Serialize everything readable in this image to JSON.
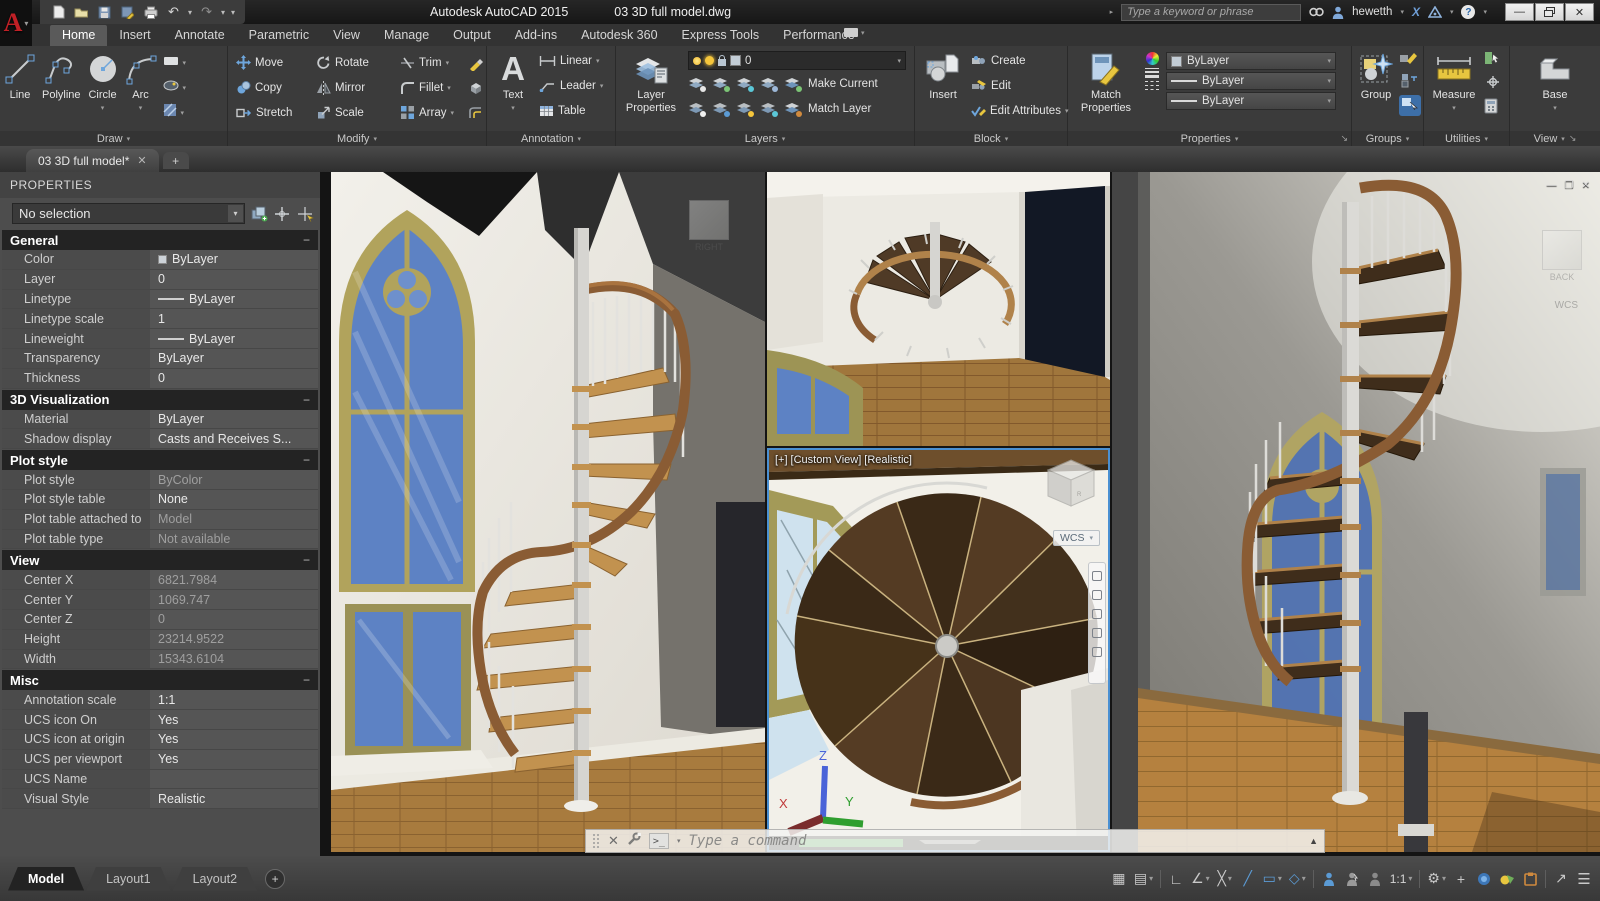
{
  "title_bar": {
    "app_title": "Autodesk AutoCAD 2015",
    "doc_title": "03 3D full model.dwg",
    "search_placeholder": "Type a keyword or phrase",
    "username": "hewetth"
  },
  "ribbon": {
    "tabs": [
      "Home",
      "Insert",
      "Annotate",
      "Parametric",
      "View",
      "Manage",
      "Output",
      "Add-ins",
      "Autodesk 360",
      "Express Tools",
      "Performance"
    ],
    "active_tab": "Home",
    "draw": {
      "label": "Draw",
      "line": "Line",
      "polyline": "Polyline",
      "circle": "Circle",
      "arc": "Arc"
    },
    "modify": {
      "label": "Modify",
      "move": "Move",
      "rotate": "Rotate",
      "trim": "Trim",
      "copy": "Copy",
      "mirror": "Mirror",
      "fillet": "Fillet",
      "stretch": "Stretch",
      "scale": "Scale",
      "array": "Array"
    },
    "annotation": {
      "label": "Annotation",
      "text": "Text",
      "linear": "Linear",
      "leader": "Leader",
      "table": "Table"
    },
    "layers": {
      "label": "Layers",
      "layer_properties": "Layer Properties",
      "current_layer": "0",
      "make_current": "Make Current",
      "match_layer": "Match Layer"
    },
    "block": {
      "label": "Block",
      "insert": "Insert",
      "create": "Create",
      "edit": "Edit",
      "edit_attributes": "Edit Attributes"
    },
    "properties": {
      "label": "Properties",
      "match_properties": "Match Properties",
      "color": "ByLayer",
      "lineweight": "ByLayer",
      "linetype": "ByLayer"
    },
    "groups": {
      "label": "Groups",
      "group": "Group"
    },
    "utilities": {
      "label": "Utilities",
      "measure": "Measure"
    },
    "view": {
      "label": "View",
      "base": "Base"
    }
  },
  "file_tabs": {
    "active": "03 3D full model*"
  },
  "properties_palette": {
    "title": "PROPERTIES",
    "selector": "No selection",
    "sections": [
      {
        "title": "General",
        "rows": [
          {
            "label": "Color",
            "value": "ByLayer",
            "prefix": "swatch"
          },
          {
            "label": "Layer",
            "value": "0"
          },
          {
            "label": "Linetype",
            "value": "ByLayer",
            "prefix": "line"
          },
          {
            "label": "Linetype scale",
            "value": "1"
          },
          {
            "label": "Lineweight",
            "value": "ByLayer",
            "prefix": "line"
          },
          {
            "label": "Transparency",
            "value": "ByLayer"
          },
          {
            "label": "Thickness",
            "value": "0"
          }
        ]
      },
      {
        "title": "3D Visualization",
        "rows": [
          {
            "label": "Material",
            "value": "ByLayer"
          },
          {
            "label": "Shadow display",
            "value": "Casts and Receives S..."
          }
        ]
      },
      {
        "title": "Plot style",
        "rows": [
          {
            "label": "Plot style",
            "value": "ByColor",
            "dim": true
          },
          {
            "label": "Plot style table",
            "value": "None"
          },
          {
            "label": "Plot table attached to",
            "value": "Model",
            "dim": true
          },
          {
            "label": "Plot table type",
            "value": "Not available",
            "dim": true
          }
        ]
      },
      {
        "title": "View",
        "rows": [
          {
            "label": "Center X",
            "value": "6821.7984",
            "dim": true
          },
          {
            "label": "Center Y",
            "value": "1069.747",
            "dim": true
          },
          {
            "label": "Center Z",
            "value": "0",
            "dim": true
          },
          {
            "label": "Height",
            "value": "23214.9522",
            "dim": true
          },
          {
            "label": "Width",
            "value": "15343.6104",
            "dim": true
          }
        ]
      },
      {
        "title": "Misc",
        "rows": [
          {
            "label": "Annotation scale",
            "value": "1:1"
          },
          {
            "label": "UCS icon On",
            "value": "Yes"
          },
          {
            "label": "UCS icon at origin",
            "value": "Yes"
          },
          {
            "label": "UCS per viewport",
            "value": "Yes"
          },
          {
            "label": "UCS Name",
            "value": ""
          },
          {
            "label": "Visual Style",
            "value": "Realistic"
          }
        ]
      }
    ]
  },
  "viewport": {
    "active_label_plus": "[+]",
    "active_label_view": "[Custom View]",
    "active_label_style": "[Realistic]",
    "wcs_label": "WCS",
    "viewcube_right": "RIGHT",
    "viewcube_back": "BACK",
    "axis_x": "X",
    "axis_y": "Y",
    "axis_z": "Z"
  },
  "command_line": {
    "placeholder": "Type a command"
  },
  "layout_tabs": {
    "model": "Model",
    "layout1": "Layout1",
    "layout2": "Layout2"
  },
  "status_bar": {
    "annotation_scale": "1:1"
  }
}
